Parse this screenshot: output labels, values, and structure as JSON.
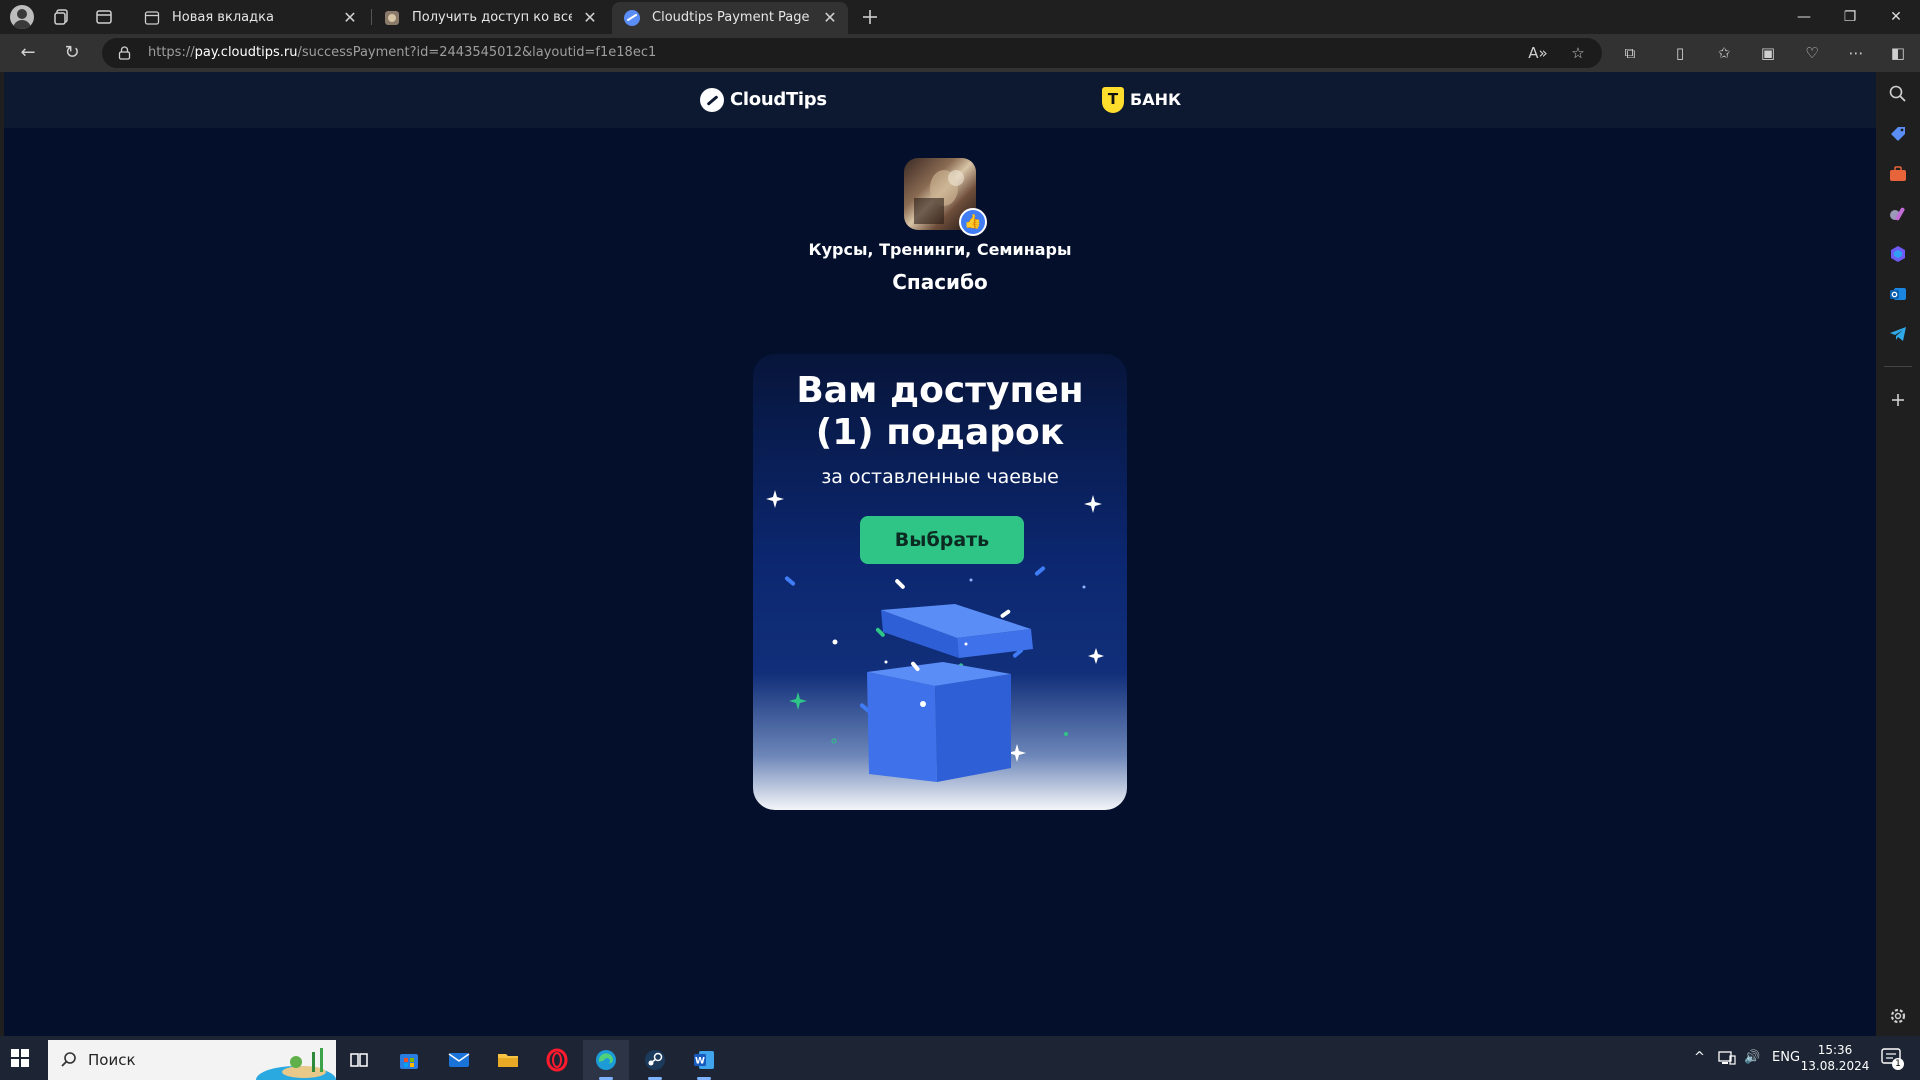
{
  "browser": {
    "tabs": [
      {
        "title": "Новая вкладка",
        "active": false
      },
      {
        "title": "Получить доступ ко всем матер",
        "active": false
      },
      {
        "title": "Cloudtips Payment Page",
        "active": true
      }
    ],
    "url_prefix": "https://",
    "url_domain": "pay.cloudtips.ru",
    "url_path": "/successPayment?id=2443545012&layoutid=f1e18ec1"
  },
  "site": {
    "brand": "CloudTips",
    "partner": "БАНК",
    "partner_logo_letter": "Т",
    "category": "Курсы, Тренинги, Семинары",
    "thanks": "Спасибо"
  },
  "gift_card": {
    "title_line1": "Вам доступен",
    "title_line2": "(1) подарок",
    "subtitle": "за оставленные чаевые",
    "button_label": "Выбрать"
  },
  "taskbar": {
    "search_placeholder": "Поиск",
    "language": "ENG",
    "time": "15:36",
    "date": "13.08.2024",
    "notification_count": "1"
  },
  "colors": {
    "page_bg": "#030f2b",
    "header_bg": "#0c1931",
    "accent_green": "#2fc586",
    "badge_blue": "#3f7cf6",
    "tbank_yellow": "#ffdd2d"
  }
}
